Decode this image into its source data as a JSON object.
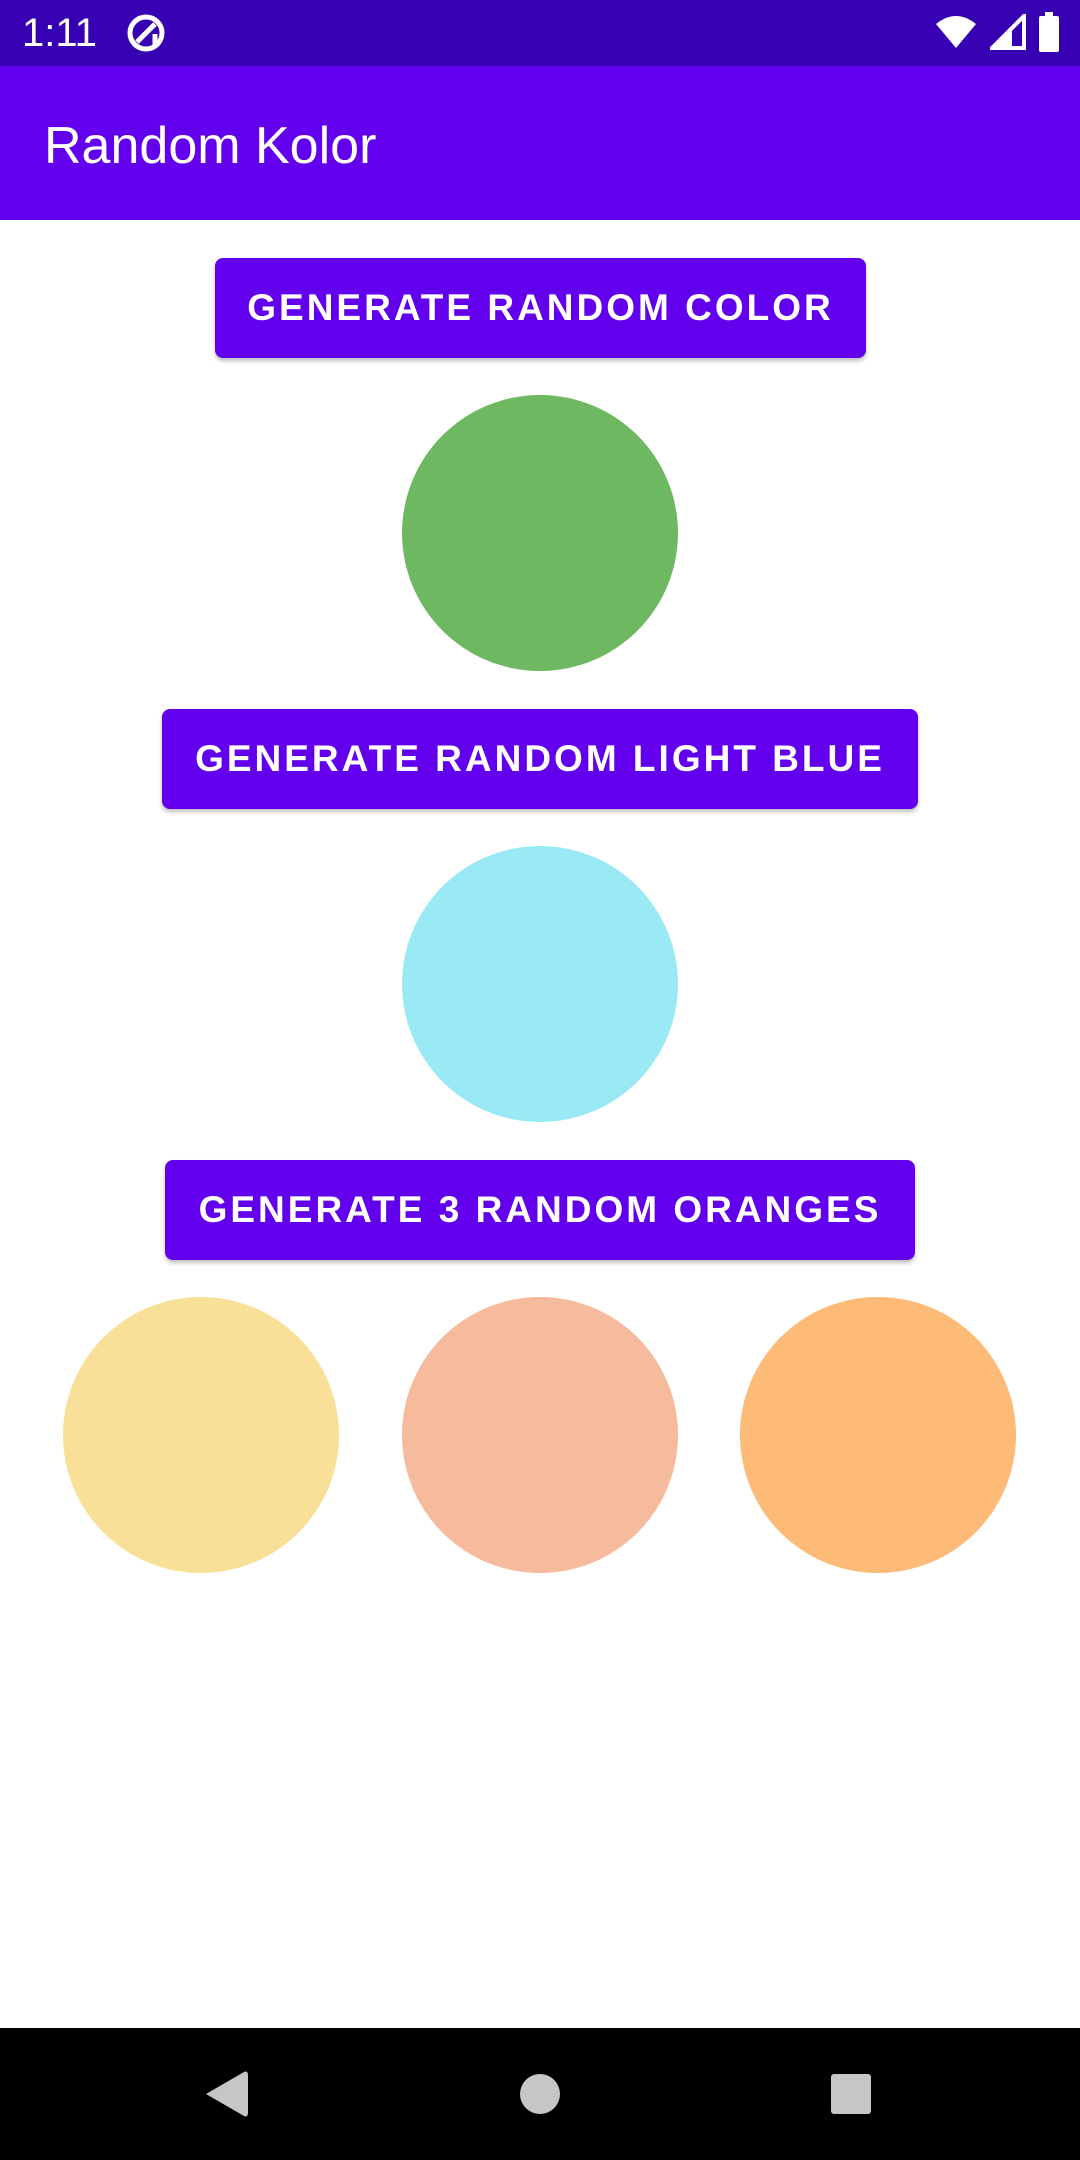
{
  "status_bar": {
    "time": "1:11",
    "background": "#3700b3",
    "icons": [
      "app-notification-icon",
      "wifi-icon",
      "cell-signal-icon",
      "battery-icon"
    ]
  },
  "app_bar": {
    "title": "Random Kolor",
    "background": "#6200ee"
  },
  "main": {
    "random_color": {
      "button_label": "GENERATE RANDOM COLOR",
      "circle_color": "#6fb862"
    },
    "light_blue": {
      "button_label": "GENERATE RANDOM LIGHT BLUE",
      "circle_color": "#9aeaf6"
    },
    "oranges": {
      "button_label": "GENERATE 3 RANDOM ORANGES",
      "circle_colors": [
        "#f8e098",
        "#f6ba9c",
        "#feba77"
      ]
    }
  },
  "nav_bar": {
    "icons": [
      "back-icon",
      "home-icon",
      "recents-icon"
    ]
  },
  "colors": {
    "accent": "#6200ee",
    "status_bar": "#3700b3",
    "button_text": "#ffffff"
  }
}
